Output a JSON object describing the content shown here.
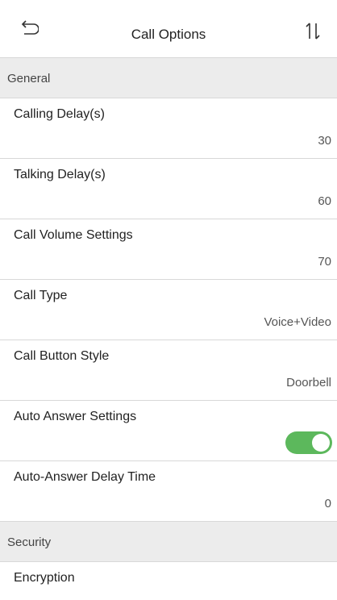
{
  "header": {
    "title": "Call Options",
    "back_icon": "back-arrow-icon",
    "sort_icon": "sort-arrows-icon"
  },
  "sections": [
    {
      "label": "General"
    },
    {
      "label": "Security"
    }
  ],
  "items": [
    {
      "label": "Calling Delay(s)",
      "value": "30"
    },
    {
      "label": "Talking Delay(s)",
      "value": "60"
    },
    {
      "label": "Call Volume Settings",
      "value": "70"
    },
    {
      "label": "Call Type",
      "value": "Voice+Video"
    },
    {
      "label": "Call Button Style",
      "value": "Doorbell"
    },
    {
      "label": "Auto Answer Settings",
      "toggle_on": true,
      "toggle_color": "#5cb85c"
    },
    {
      "label": "Auto-Answer Delay Time",
      "value": "0"
    },
    {
      "label": "Encryption"
    }
  ]
}
